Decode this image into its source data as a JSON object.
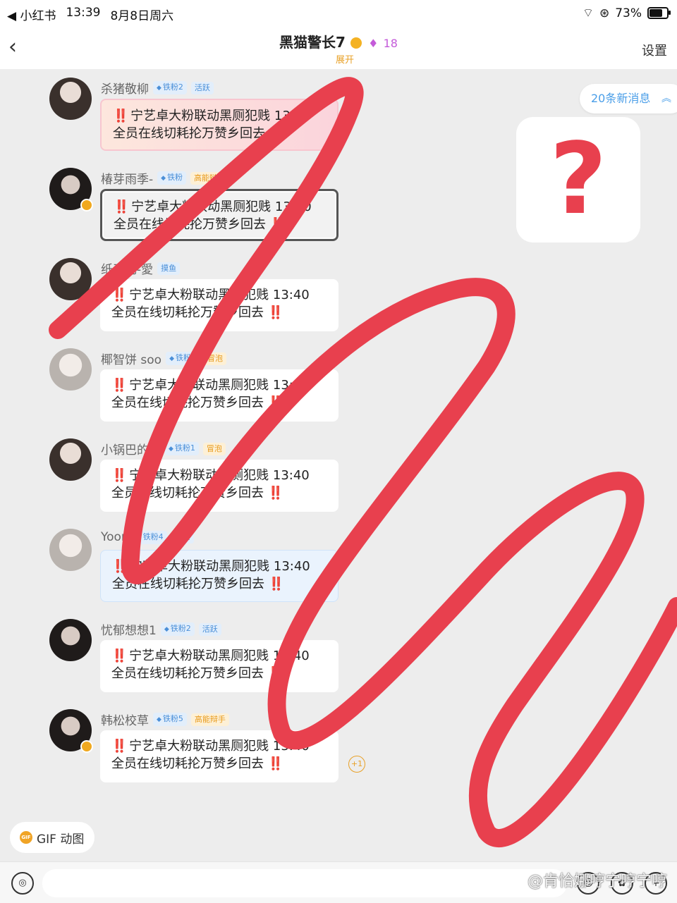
{
  "status_bar": {
    "back_app": "◀ 小红书",
    "time": "13:39",
    "date": "8月8日周六",
    "battery": "73%"
  },
  "header": {
    "title": "黑猫警长7",
    "member_count": "18",
    "expand": "展开",
    "settings": "设置"
  },
  "new_messages": "20条新消息",
  "question_mark": "?",
  "messages": [
    {
      "name": "杀猪敬柳",
      "tags": [
        "铁粉2",
        "活跃"
      ],
      "line1": "宁艺卓大粉联动黑厕犯贱 13:40",
      "line2": "全员在线切耗抡万赞乡回去"
    },
    {
      "name": "椿芽雨季-",
      "tags": [
        "铁粉",
        "高能辩手"
      ],
      "line1": "宁艺卓大粉联动黑厕犯贱 13:40",
      "line2": "全员在线切耗抡万赞乡回去"
    },
    {
      "name": "纸天见-愛",
      "tags": [
        "摸鱼"
      ],
      "line1": "宁艺卓大粉联动黑厕犯贱 13:40",
      "line2": "全员在线切耗抡万赞乡回去"
    },
    {
      "name": "椰智饼 soo",
      "tags": [
        "铁粉2",
        "冒泡"
      ],
      "line1": "宁艺卓大粉联动黑厕犯贱 13:40",
      "line2": "全员在线切耗抡万赞乡回去"
    },
    {
      "name": "小锅巴的围",
      "tags": [
        "铁粉1",
        "冒泡"
      ],
      "line1": "宁艺卓大粉联动黑厕犯贱 13:40",
      "line2": "全员在线切耗抡万赞乡回去"
    },
    {
      "name": "Yoon",
      "tags": [
        "铁粉4",
        "摸鱼"
      ],
      "line1": "宁艺卓大粉联动黑厕犯贱 13:40",
      "line2": "全员在线切耗抡万赞乡回去"
    },
    {
      "name": "忧郁想想1",
      "tags": [
        "铁粉2",
        "活跃"
      ],
      "line1": "宁艺卓大粉联动黑厕犯贱 13:40",
      "line2": "全员在线切耗抡万赞乡回去"
    },
    {
      "name": "韩松校草",
      "tags": [
        "铁粉5",
        "高能辩手"
      ],
      "line1": "宁艺卓大粉联动黑厕犯贱 13:40",
      "line2": "全员在线切耗抡万赞乡回去",
      "reaction": "+1"
    }
  ],
  "exclaim": "‼️",
  "gif_button": {
    "icon_text": "GIF",
    "label": "GIF 动图"
  },
  "input": {
    "placeholder": ""
  },
  "watermark": "@肯恰娜哼宁哼宁哼",
  "colors": {
    "accent": "#4a9ee8",
    "scribble": "#e8404e",
    "badge": "#e8a026"
  }
}
